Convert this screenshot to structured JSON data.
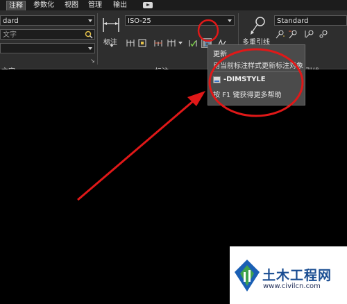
{
  "tabs": [
    {
      "label": "注释",
      "active": true
    },
    {
      "label": "参数化",
      "active": false
    },
    {
      "label": "视图",
      "active": false
    },
    {
      "label": "管理",
      "active": false
    },
    {
      "label": "输出",
      "active": false
    }
  ],
  "text_panel": {
    "style_value": "dard",
    "search_placeholder": "文字",
    "footer": "文字"
  },
  "dimension_panel": {
    "big_button_label": "标注",
    "style_value": "ISO-25",
    "footer": "标注"
  },
  "multileader_panel": {
    "big_button_label": "多重引线",
    "style_value": "Standard",
    "footer_fragment": "引线"
  },
  "tooltip": {
    "title": "更新",
    "description": "用当前标注样式更新标注对象",
    "command": "-DIMSTYLE",
    "help": "按 F1 键获得更多帮助"
  },
  "watermark": {
    "name": "土木工程网",
    "url": "www.civilcn.com"
  },
  "colors": {
    "annotation_red": "#e01818",
    "canvas": "#000000",
    "ribbon": "#2e2e2e"
  },
  "icons": [
    "video-icon",
    "find-text-icon",
    "linear-dimension-icon",
    "multileader-icon",
    "update-dimension-icon",
    "dimstyle-icon",
    "civilcn-logo"
  ]
}
